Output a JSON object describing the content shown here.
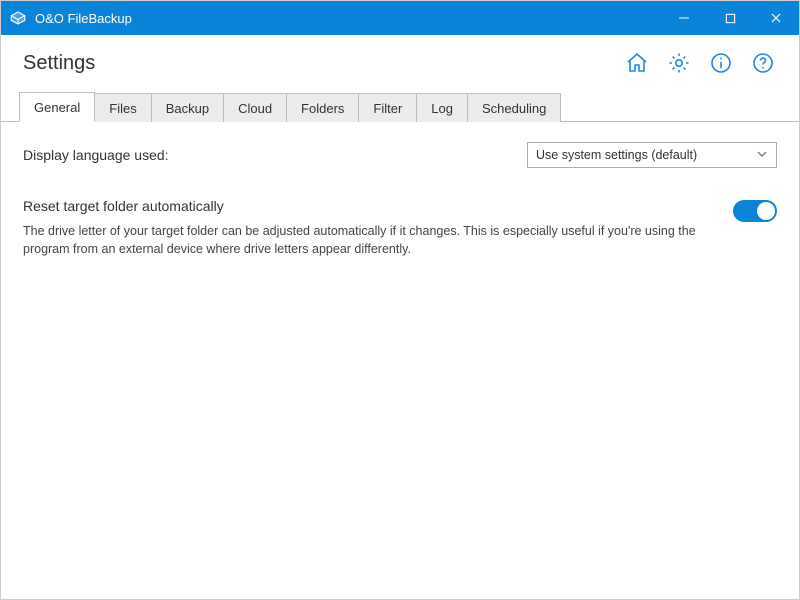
{
  "titlebar": {
    "app_name": "O&O FileBackup"
  },
  "header": {
    "title": "Settings"
  },
  "header_icons": {
    "home": "home-icon",
    "settings": "gear-icon",
    "info": "info-icon",
    "help": "help-icon"
  },
  "tabs": [
    {
      "label": "General",
      "active": true
    },
    {
      "label": "Files"
    },
    {
      "label": "Backup"
    },
    {
      "label": "Cloud"
    },
    {
      "label": "Folders"
    },
    {
      "label": "Filter"
    },
    {
      "label": "Log"
    },
    {
      "label": "Scheduling"
    }
  ],
  "general": {
    "language_label": "Display language used:",
    "language_value": "Use system settings (default)",
    "reset_title": "Reset target folder automatically",
    "reset_desc": "The drive letter of your target folder can be adjusted automatically if it changes. This is especially useful if you're using the program from an external device where drive letters appear differently.",
    "reset_toggle": true
  }
}
